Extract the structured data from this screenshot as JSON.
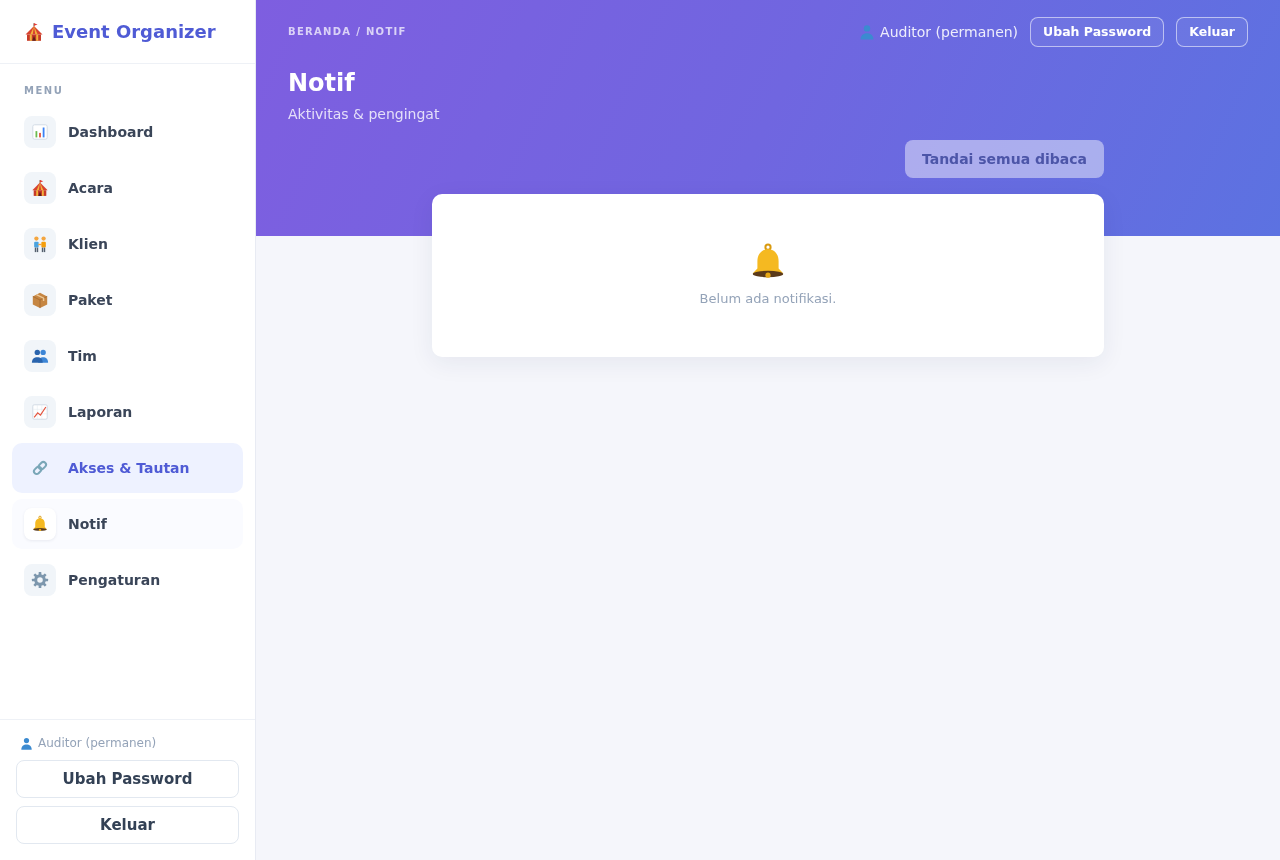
{
  "sidebar": {
    "brand": "Event Organizer",
    "menu_label": "MENU",
    "items": [
      {
        "label": "Dashboard",
        "selected": false,
        "hovered": false
      },
      {
        "label": "Acara",
        "selected": false,
        "hovered": false
      },
      {
        "label": "Klien",
        "selected": false,
        "hovered": false
      },
      {
        "label": "Paket",
        "selected": false,
        "hovered": false
      },
      {
        "label": "Tim",
        "selected": false,
        "hovered": false
      },
      {
        "label": "Laporan",
        "selected": false,
        "hovered": false
      },
      {
        "label": "Akses & Tautan",
        "selected": false,
        "hovered": true
      },
      {
        "label": "Notif",
        "selected": true,
        "hovered": false
      },
      {
        "label": "Pengaturan",
        "selected": false,
        "hovered": false
      }
    ],
    "user": "Auditor (permanen)",
    "buttons": [
      "Ubah Password",
      "Keluar"
    ]
  },
  "header": {
    "breadcrumb": "BERANDA / NOTIF",
    "user": "Auditor (permanen)",
    "buttons": [
      "Ubah Password",
      "Keluar"
    ],
    "title": "Notif",
    "subtitle": "Aktivitas & pengingat"
  },
  "toolbar": {
    "mark_all_read": {
      "label": "Tandai semua dibaca",
      "disabled": true
    }
  },
  "notifications": {
    "empty_message": "Belum ada notifikasi."
  }
}
